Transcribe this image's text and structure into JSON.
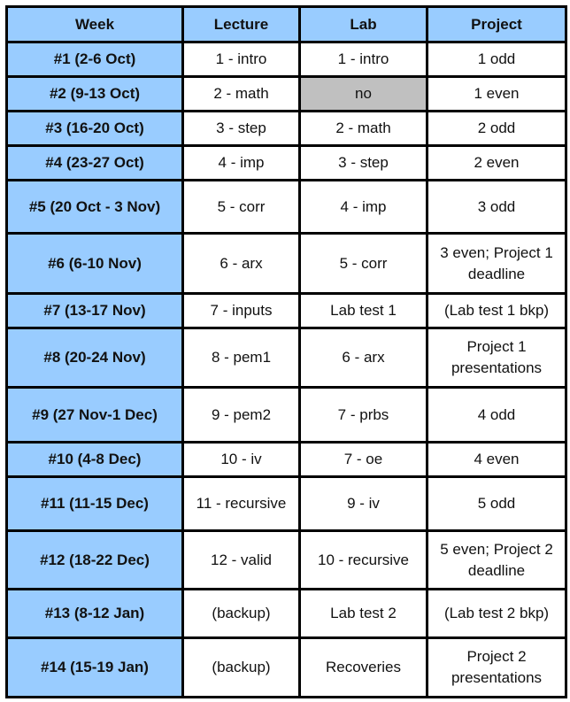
{
  "table": {
    "headers": [
      "Week",
      "Lecture",
      "Lab",
      "Project"
    ],
    "rows": [
      {
        "week": "#1 (2-6 Oct)",
        "lecture": "1 - intro",
        "lab": "1 - intro",
        "project": "1 odd"
      },
      {
        "week": "#2 (9-13 Oct)",
        "lecture": "2 - math",
        "lab": "no",
        "project": "1 even"
      },
      {
        "week": "#3 (16-20 Oct)",
        "lecture": "3 - step",
        "lab": "2 - math",
        "project": "2 odd"
      },
      {
        "week": "#4 (23-27 Oct)",
        "lecture": "4 - imp",
        "lab": "3 - step",
        "project": "2 even"
      },
      {
        "week": "#5 (20 Oct - 3 Nov)",
        "lecture": "5 - corr",
        "lab": "4 - imp",
        "project": "3 odd"
      },
      {
        "week": "#6 (6-10 Nov)",
        "lecture": "6 - arx",
        "lab": "5 - corr",
        "project": "3 even; Project 1 deadline"
      },
      {
        "week": "#7 (13-17 Nov)",
        "lecture": "7 - inputs",
        "lab": "Lab test 1",
        "project": "(Lab test 1 bkp)"
      },
      {
        "week": "#8 (20-24 Nov)",
        "lecture": "8 - pem1",
        "lab": "6 - arx",
        "project": "Project 1 presentations"
      },
      {
        "week": "#9 (27 Nov-1 Dec)",
        "lecture": "9 - pem2",
        "lab": "7 - prbs",
        "project": "4 odd"
      },
      {
        "week": "#10 (4-8 Dec)",
        "lecture": "10 - iv",
        "lab": "7 - oe",
        "project": "4 even"
      },
      {
        "week": "#11 (11-15 Dec)",
        "lecture": "11 - recursive",
        "lab": "9 - iv",
        "project": "5 odd"
      },
      {
        "week": "#12 (18-22 Dec)",
        "lecture": "12 - valid",
        "lab": "10 - recursive",
        "project": "5 even; Project 2 deadline"
      },
      {
        "week": "#13 (8-12 Jan)",
        "lecture": "(backup)",
        "lab": "Lab test 2",
        "project": "(Lab test 2 bkp)"
      },
      {
        "week": "#14 (15-19 Jan)",
        "lecture": "(backup)",
        "lab": "Recoveries",
        "project": "Project 2 presentations"
      }
    ]
  },
  "colors": {
    "header_fill": "#99ccff",
    "week_fill": "#99ccff",
    "no_lab_fill": "#c0c0c0",
    "border": "#000000"
  }
}
